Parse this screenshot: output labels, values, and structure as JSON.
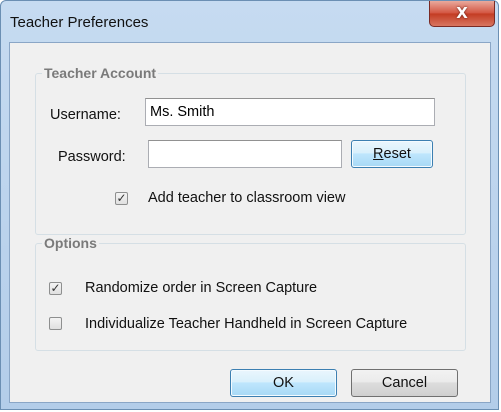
{
  "window": {
    "title": "Teacher Preferences",
    "close_glyph": "X"
  },
  "teacher_account": {
    "legend": "Teacher Account",
    "username_label": "Username:",
    "username_value": "Ms. Smith",
    "password_label": "Password:",
    "password_value": "",
    "reset_label_prefix": "",
    "reset_label_mnemonic": "R",
    "reset_label_rest": "eset",
    "add_teacher_label": "Add teacher to classroom view",
    "add_teacher_checked": true
  },
  "options": {
    "legend": "Options",
    "randomize_label": "Randomize order in Screen Capture",
    "randomize_checked": true,
    "individualize_label": "Individualize Teacher Handheld in Screen Capture",
    "individualize_checked": false
  },
  "footer": {
    "ok_label": "OK",
    "cancel_label": "Cancel"
  },
  "icons": {
    "check_glyph": "✓"
  }
}
